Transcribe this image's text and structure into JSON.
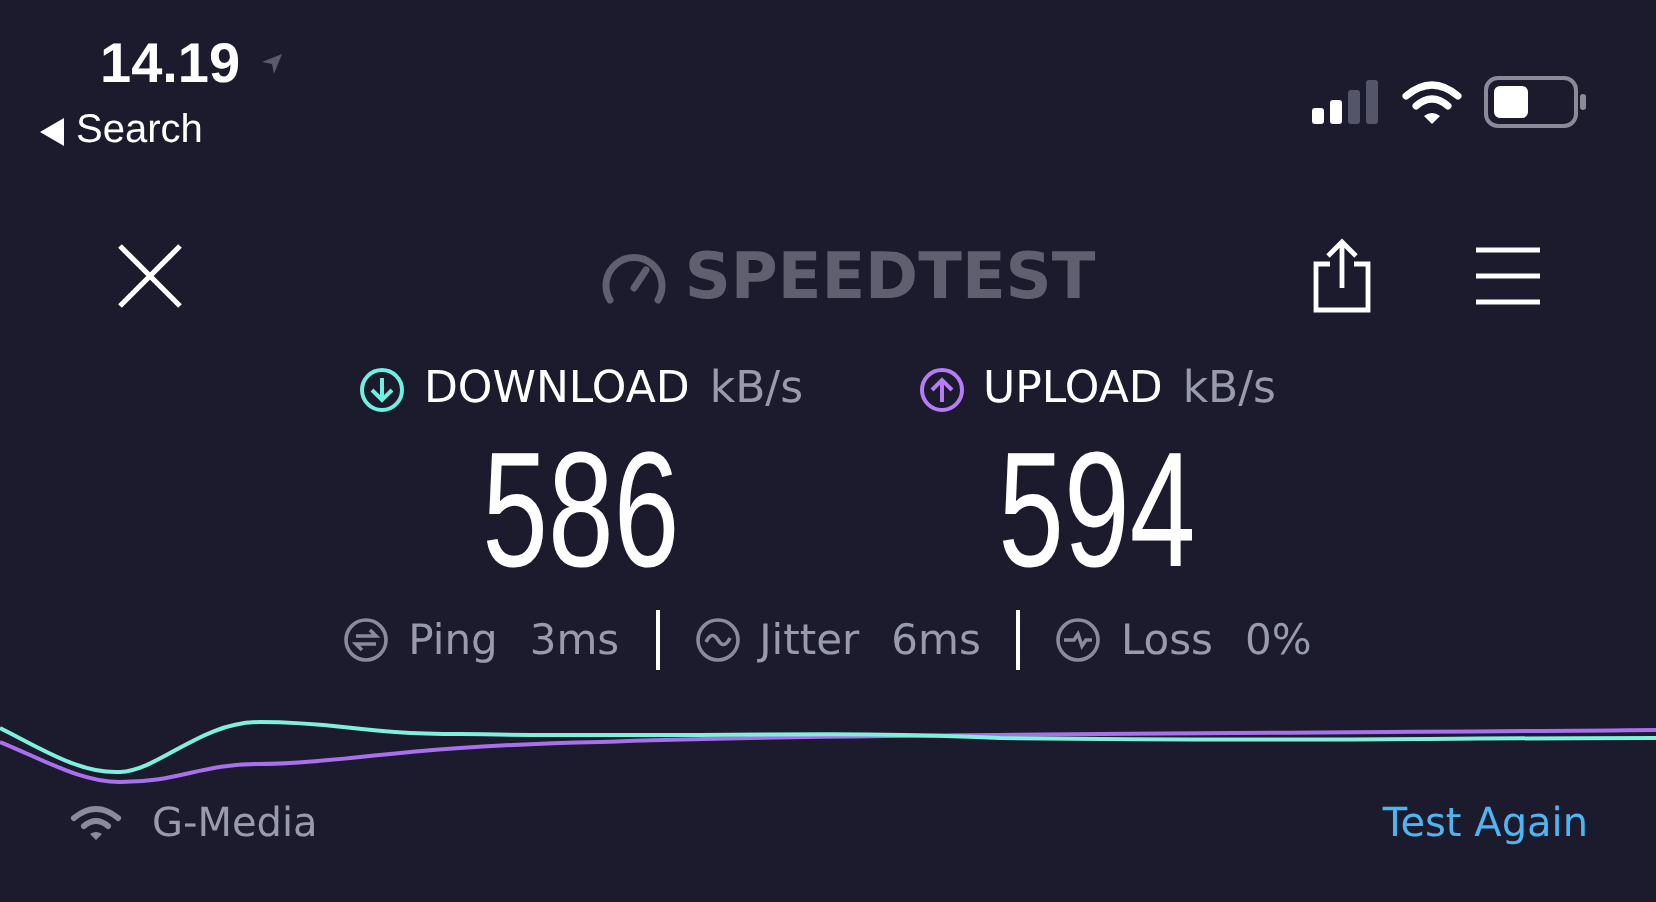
{
  "status_bar": {
    "time": "14.19",
    "back_label": "Search"
  },
  "header": {
    "title": "SPEEDTEST"
  },
  "results": [
    {
      "kind": "download",
      "label": "DOWNLOAD",
      "unit": "kB/s",
      "value": "586"
    },
    {
      "kind": "upload",
      "label": "UPLOAD",
      "unit": "kB/s",
      "value": "594"
    }
  ],
  "stats": [
    {
      "kind": "ping",
      "label": "Ping",
      "value": "3ms"
    },
    {
      "kind": "jitter",
      "label": "Jitter",
      "value": "6ms"
    },
    {
      "kind": "loss",
      "label": "Loss",
      "value": "0%"
    }
  ],
  "footer": {
    "network": "G-Media",
    "action": "Test Again"
  }
}
